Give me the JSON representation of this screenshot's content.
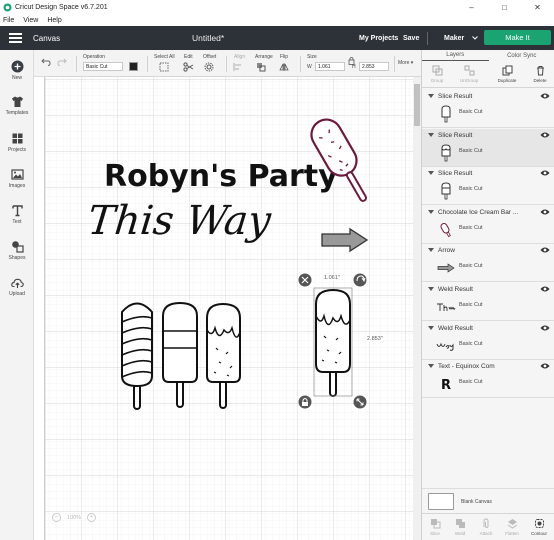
{
  "window": {
    "title": "Cricut Design Space  v6.7.201"
  },
  "menu": {
    "file": "File",
    "view": "View",
    "help": "Help"
  },
  "header": {
    "canvas_label": "Canvas",
    "doc_title": "Untitled*",
    "my_projects": "My Projects",
    "save": "Save",
    "machine": "Maker",
    "make_it": "Make It",
    "brand_color": "#1aa472",
    "bar_color": "#2d3138"
  },
  "toolbar": {
    "operation_label": "Operation",
    "operation_value": "Basic Cut",
    "select_all": "Select All",
    "edit": "Edit",
    "offset": "Offset",
    "align": "Align",
    "arrange": "Arrange",
    "flip": "Flip",
    "size": "Size",
    "w_label": "W",
    "w_value": "1.061",
    "h_label": "H",
    "h_value": "2.853",
    "more": "More"
  },
  "sidebar": {
    "items": [
      {
        "label": "New",
        "icon": "plus-icon"
      },
      {
        "label": "Templates",
        "icon": "shirt-icon"
      },
      {
        "label": "Projects",
        "icon": "grid-icon"
      },
      {
        "label": "Images",
        "icon": "image-icon"
      },
      {
        "label": "Text",
        "icon": "text-icon"
      },
      {
        "label": "Shapes",
        "icon": "shapes-icon"
      },
      {
        "label": "Upload",
        "icon": "upload-icon"
      }
    ]
  },
  "canvas": {
    "title_text": "Robyn's Party",
    "script_text": "This Way",
    "width_readout": "1.061\"",
    "height_readout": "2.853\"",
    "zoom": "100%",
    "accent_color": "#6b1a3d"
  },
  "panel": {
    "tab_layers": "Layers",
    "tab_color_sync": "Color Sync",
    "actions": {
      "group": "Group",
      "ungroup": "UnGroup",
      "duplicate": "Duplicate",
      "delete": "Delete"
    },
    "layers": [
      {
        "name": "Slice Result",
        "op": "Basic Cut",
        "selected": false
      },
      {
        "name": "Slice Result",
        "op": "Basic Cut",
        "selected": true
      },
      {
        "name": "Slice Result",
        "op": "Basic Cut",
        "selected": false
      },
      {
        "name": "Chocolate Ice Cream Bar ...",
        "op": "Basic Cut",
        "selected": false
      },
      {
        "name": "Arrow",
        "op": "Basic Cut",
        "selected": false
      },
      {
        "name": "Weld Result",
        "op": "Basic Cut",
        "selected": false
      },
      {
        "name": "Weld Result",
        "op": "Basic Cut",
        "selected": false
      },
      {
        "name": "Text - Equinox Com",
        "op": "Basic Cut",
        "selected": false
      }
    ],
    "blank_canvas": "Blank Canvas",
    "bottom_actions": {
      "slice": "Slice",
      "weld": "Weld",
      "attach": "Attach",
      "flatten": "Flatten",
      "contour": "Contour"
    }
  }
}
